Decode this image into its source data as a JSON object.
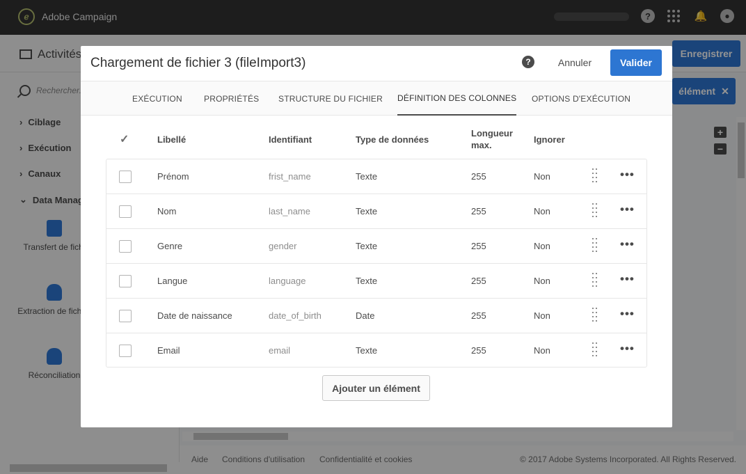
{
  "app": {
    "brand": "Adobe Campaign"
  },
  "background": {
    "page_title": "Activités",
    "save_label": "Enregistrer",
    "element_label": "élément",
    "search_placeholder": "Rechercher...",
    "sidebar_items": [
      "Ciblage",
      "Exécution",
      "Canaux",
      "Data Manage"
    ],
    "tools": [
      {
        "label": "Transfert de fichi"
      },
      {
        "label": "Extraction de fichier"
      },
      {
        "label": "Réconciliation"
      }
    ],
    "footer": {
      "help": "Aide",
      "terms": "Conditions d'utilisation",
      "privacy": "Confidentialité et cookies",
      "copyright": "© 2017 Adobe Systems Incorporated. All Rights Reserved."
    }
  },
  "modal": {
    "title": "Chargement de fichier 3 (fileImport3)",
    "cancel_label": "Annuler",
    "validate_label": "Valider",
    "tabs": [
      {
        "label": "EXÉCUTION",
        "active": false
      },
      {
        "label": "PROPRIÉTÉS",
        "active": false
      },
      {
        "label": "STRUCTURE DU FICHIER",
        "active": false
      },
      {
        "label": "DÉFINITION DES COLONNES",
        "active": true
      },
      {
        "label": "OPTIONS D'EXÉCUTION",
        "active": false
      }
    ],
    "columns": {
      "label": "Libellé",
      "identifier": "Identifiant",
      "data_type": "Type de données",
      "max_length": "Longueur max.",
      "ignore": "Ignorer"
    },
    "rows": [
      {
        "label": "Prénom",
        "identifier": "frist_name",
        "data_type": "Texte",
        "max_length": "255",
        "ignore": "Non"
      },
      {
        "label": "Nom",
        "identifier": "last_name",
        "data_type": "Texte",
        "max_length": "255",
        "ignore": "Non"
      },
      {
        "label": "Genre",
        "identifier": "gender",
        "data_type": "Texte",
        "max_length": "255",
        "ignore": "Non"
      },
      {
        "label": "Langue",
        "identifier": "language",
        "data_type": "Texte",
        "max_length": "255",
        "ignore": "Non"
      },
      {
        "label": "Date de naissance",
        "identifier": "date_of_birth",
        "data_type": "Date",
        "max_length": "255",
        "ignore": "Non"
      },
      {
        "label": "Email",
        "identifier": "email",
        "data_type": "Texte",
        "max_length": "255",
        "ignore": "Non"
      }
    ],
    "add_label": "Ajouter un élément"
  },
  "colors": {
    "accent": "#2d76d2",
    "topbar": "#323232"
  }
}
